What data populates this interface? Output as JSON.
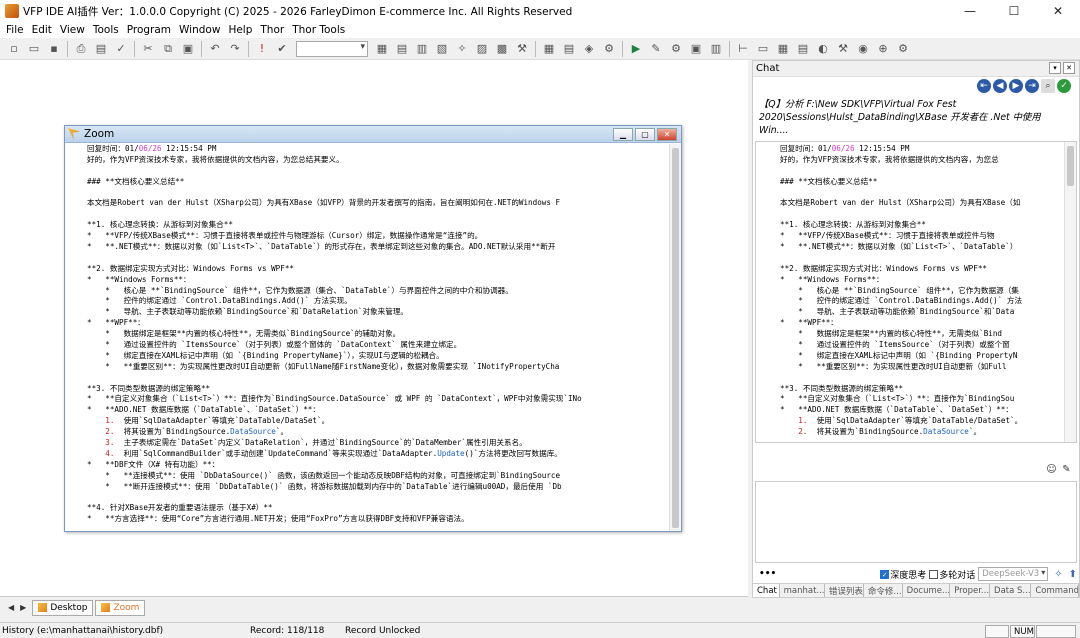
{
  "window": {
    "title": "VFP IDE AI插件  Ver：1.0.0.0  Copyright (C) 2025 - 2026 FarleyDimon  E-commerce Inc. All Rights Reserved",
    "minimize": "—",
    "maximize": "☐",
    "close": "✕"
  },
  "menu": [
    "File",
    "Edit",
    "View",
    "Tools",
    "Program",
    "Window",
    "Help",
    "Thor",
    "Thor Tools"
  ],
  "toolbar": {
    "icons": [
      "new-file-icon",
      "open-icon",
      "save-icon",
      "print-icon",
      "print-preview-icon",
      "spell-check-icon",
      "cut-icon",
      "copy-icon",
      "paste-icon",
      "undo-icon",
      "redo-icon",
      "exclamation-icon",
      "check-icon"
    ],
    "icons2": [
      "form-designer-icon",
      "report-icon",
      "label-icon",
      "class-icon",
      "wizard-icon",
      "query-icon",
      "connection-icon",
      "builder-icon",
      "properties-icon",
      "code-icon",
      "data-session-icon",
      "settings-icon",
      "run-icon",
      "modify-icon",
      "debug-icon",
      "view-icon",
      "layout-icon",
      "align-icon",
      "order-icon",
      "group-icon",
      "tab-icon",
      "color-icon",
      "font-icon",
      "tools-icon",
      "sort-icon"
    ]
  },
  "zoom": {
    "title": "Zoom",
    "lines": [
      [
        [
          "回复时间：01/",
          "n"
        ],
        [
          "06/26",
          "p"
        ],
        [
          " 12:15:54 PM",
          "n"
        ]
      ],
      [
        [
          "好的，作为VFP资深技术专家，我将依据提供的文档内容，为您总结其要义。",
          "n"
        ]
      ],
      [
        [
          "",
          "n"
        ]
      ],
      [
        [
          "### **文档核心要义总结**",
          "n"
        ]
      ],
      [
        [
          "",
          "n"
        ]
      ],
      [
        [
          "本文档是Robert van der Hulst（XSharp公司）为具有XBase（如VFP）背景的开发者撰写的指南，旨在阐明如何在.NET的Windows F",
          "n"
        ]
      ],
      [
        [
          "",
          "n"
        ]
      ],
      [
        [
          "**1. 核心理念转换：从游标到对象集合**",
          "n"
        ]
      ],
      [
        [
          "*   **VFP/传统XBase模式**：习惯于直接将表单或控件与物理游标（Cursor）绑定，数据操作通常是“连接”的。",
          "n"
        ]
      ],
      [
        [
          "*   **.NET模式**：数据以对象（如`List<T>`、`DataTable`）的形式存在，表单绑定到这些对象的集合。ADO.NET默认采用**断开",
          "n"
        ]
      ],
      [
        [
          "",
          "n"
        ]
      ],
      [
        [
          "**2. 数据绑定实现方式对比：Windows Forms vs WPF**",
          "n"
        ]
      ],
      [
        [
          "*   **Windows Forms**：",
          "n"
        ]
      ],
      [
        [
          "    *   核心是 **`BindingSource` 组件**，它作为数据源（集合、`DataTable`）与界面控件之间的中介和协调器。",
          "n"
        ]
      ],
      [
        [
          "    *   控件的绑定通过 `Control.DataBindings.Add()` 方法实现。",
          "n"
        ]
      ],
      [
        [
          "    *   导航、主子表联动等功能依赖`BindingSource`和`DataRelation`对象来管理。",
          "n"
        ]
      ],
      [
        [
          "*   **WPF**：",
          "n"
        ]
      ],
      [
        [
          "    *   数据绑定是框架**内置的核心特性**，无需类似`BindingSource`的辅助对象。",
          "n"
        ]
      ],
      [
        [
          "    *   通过设置控件的 `ItemsSource`（对于列表）或整个窗体的 `DataContext` 属性来建立绑定。",
          "n"
        ]
      ],
      [
        [
          "    *   绑定直接在XAML标记中声明（如 `{Binding PropertyName}`），实现UI与逻辑的松耦合。",
          "n"
        ]
      ],
      [
        [
          "    *   **重要区别**：为实现属性更改时UI自动更新（如FullName随FirstName变化），数据对象需要实现 `INotifyPropertyCha",
          "n"
        ]
      ],
      [
        [
          "",
          "n"
        ]
      ],
      [
        [
          "**3. 不同类型数据源的绑定策略**",
          "n"
        ]
      ],
      [
        [
          "*   **自定义对象集合（`List<T>`）**：直接作为`BindingSource.DataSource` 或 WPF 的 `DataContext`，WPF中对象需实现`INo",
          "n"
        ]
      ],
      [
        [
          "*   **ADO.NET 数据库数据（`DataTable`、`DataSet`）**：",
          "n"
        ]
      ],
      [
        [
          "    ",
          "n"
        ],
        [
          "1.",
          "r"
        ],
        [
          "  使用`SqlDataAdapter`等填充`DataTable/DataSet`。",
          "n"
        ]
      ],
      [
        [
          "    ",
          "n"
        ],
        [
          "2.",
          "r"
        ],
        [
          "  将其设置为`BindingSource.",
          "n"
        ],
        [
          "DataSource",
          "b"
        ],
        [
          "`。",
          "n"
        ]
      ],
      [
        [
          "    ",
          "n"
        ],
        [
          "3.",
          "r"
        ],
        [
          "  主子表绑定需在`DataSet`内定义`DataRelation`，并通过`BindingSource`的`DataMember`属性引用关系名。",
          "n"
        ]
      ],
      [
        [
          "    ",
          "n"
        ],
        [
          "4.",
          "r"
        ],
        [
          "  利用`SqlCommandBuilder`或手动创建`UpdateCommand`等来实现通过`DataAdapter.",
          "n"
        ],
        [
          "Update",
          "b"
        ],
        [
          "()`方法将更改回写数据库。",
          "n"
        ]
      ],
      [
        [
          "*   **DBF文件（X# 特有功能）**：",
          "n"
        ]
      ],
      [
        [
          "    *   **连接模式**：使用 `DbDataSource()` 函数，该函数返回一个能动态反映DBF结构的对象，可直接绑定到`BindingSource",
          "n"
        ]
      ],
      [
        [
          "    *   **断开连接模式**：使用 `DbDataTable()` 函数，将游标数据加载到内存中的`DataTable`进行编辑u00AD，最后使用 `Db",
          "n"
        ]
      ],
      [
        [
          "",
          "n"
        ]
      ],
      [
        [
          "**4. 针对XBase开发者的重要语法提示（基于X#）**",
          "n"
        ]
      ],
      [
        [
          "*   **方言选择**：使用“Core”方言进行通用.NET开发；使用“FoxPro”方言以获得DBF支持和VFP兼容语法。",
          "n"
        ]
      ]
    ]
  },
  "tabs": {
    "nav_left": "◀",
    "nav_right": "▶",
    "desktop": "Desktop",
    "zoom": "Zoom"
  },
  "chat": {
    "title": "Chat",
    "question": "【Q】分析 F:\\New SDK\\VFP\\Virtual Fox Fest 2020\\Sessions\\Hulst_DataBinding\\XBase 开发者在 .Net 中使用 Win....",
    "lines": [
      [
        [
          "回复时间：01/",
          "n"
        ],
        [
          "06/26",
          "p"
        ],
        [
          " 12:15:54 PM",
          "n"
        ]
      ],
      [
        [
          "好的，作为VFP资深技术专家，我将依据提供的文档内容，为您总",
          "n"
        ]
      ],
      [
        [
          "",
          "n"
        ]
      ],
      [
        [
          "### **文档核心要义总结**",
          "n"
        ]
      ],
      [
        [
          "",
          "n"
        ]
      ],
      [
        [
          "本文档是Robert van der Hulst（XSharp公司）为具有XBase（如",
          "n"
        ]
      ],
      [
        [
          "",
          "n"
        ]
      ],
      [
        [
          "**1. 核心理念转换：从游标到对象集合**",
          "n"
        ]
      ],
      [
        [
          "*   **VFP/传统XBase模式**：习惯于直接将表单或控件与物",
          "n"
        ]
      ],
      [
        [
          "*   **.NET模式**：数据以对象（如`List<T>`、`DataTable`）",
          "n"
        ]
      ],
      [
        [
          "",
          "n"
        ]
      ],
      [
        [
          "**2. 数据绑定实现方式对比：Windows Forms vs WPF**",
          "n"
        ]
      ],
      [
        [
          "*   **Windows Forms**：",
          "n"
        ]
      ],
      [
        [
          "    *   核心是 **`BindingSource` 组件**，它作为数据源（集",
          "n"
        ]
      ],
      [
        [
          "    *   控件的绑定通过 `Control.DataBindings.Add()` 方法",
          "n"
        ]
      ],
      [
        [
          "    *   导航、主子表联动等功能依赖`BindingSource`和`Data",
          "n"
        ]
      ],
      [
        [
          "*   **WPF**：",
          "n"
        ]
      ],
      [
        [
          "    *   数据绑定是框架**内置的核心特性**，无需类似`Bind",
          "n"
        ]
      ],
      [
        [
          "    *   通过设置控件的 `ItemsSource`（对于列表）或整个窗",
          "n"
        ]
      ],
      [
        [
          "    *   绑定直接在XAML标记中声明（如 `{Binding PropertyN",
          "n"
        ]
      ],
      [
        [
          "    *   **重要区别**：为实现属性更改时UI自动更新（如Full",
          "n"
        ]
      ],
      [
        [
          "",
          "n"
        ]
      ],
      [
        [
          "**3. 不同类型数据源的绑定策略**",
          "n"
        ]
      ],
      [
        [
          "*   **自定义对象集合（`List<T>`）**：直接作为`BindingSou",
          "n"
        ]
      ],
      [
        [
          "*   **ADO.NET 数据库数据（`DataTable`、`DataSet`）**：",
          "n"
        ]
      ],
      [
        [
          "    ",
          "n"
        ],
        [
          "1.",
          "r"
        ],
        [
          "  使用`SqlDataAdapter`等填充`DataTable/DataSet`。",
          "n"
        ]
      ],
      [
        [
          "    ",
          "n"
        ],
        [
          "2.",
          "r"
        ],
        [
          "  将其设置为`BindingSource.",
          "n"
        ],
        [
          "DataSource",
          "b"
        ],
        [
          "`。",
          "n"
        ]
      ]
    ],
    "deep_think": "深度思考",
    "multi_turn": "多轮对话",
    "model": "DeepSeek-V3",
    "more": "•••",
    "tabs": [
      "Chat",
      "manhat...",
      "错误列表",
      "命令修...",
      "Docume...",
      "Proper...",
      "Data S...",
      "Command"
    ]
  },
  "status": {
    "history": "History (e:\\manhattanai\\history.dbf)",
    "record": "Record: 118/118",
    "lock": "Record Unlocked",
    "num": "NUM"
  },
  "colors": {
    "date_highlight": "#d040c0",
    "number_red": "#c02020",
    "keyword_blue": "#2060c0",
    "chat_nav_blue": "#2c5aa8"
  }
}
